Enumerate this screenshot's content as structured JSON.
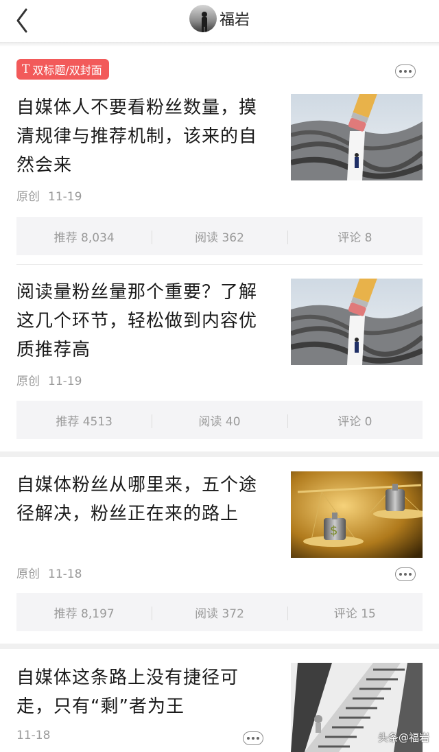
{
  "header": {
    "back_icon": "chevron-left-icon",
    "title": "福岩"
  },
  "tag": {
    "icon": "text-t-icon",
    "icon_glyph": "T",
    "label": "双标题/双封面",
    "color": "#f25a5a"
  },
  "articles": [
    {
      "title": "自媒体人不要看粉丝数量，摸清规律与推荐机制，该来的自然会来",
      "source": "原创",
      "date": "11-19",
      "recommend": "推荐 8,034",
      "read": "阅读 362",
      "comment": "评论 8"
    },
    {
      "title": "阅读量粉丝量那个重要？了解这几个环节，轻松做到内容优质推荐高",
      "source": "原创",
      "date": "11-19",
      "recommend": "推荐 4513",
      "read": "阅读 40",
      "comment": "评论 0"
    },
    {
      "title": "自媒体粉丝从哪里来，五个途径解决，粉丝正在来的路上",
      "source": "原创",
      "date": "11-18",
      "recommend": "推荐 8,197",
      "read": "阅读 372",
      "comment": "评论 15"
    },
    {
      "title": "自媒体这条路上没有捷径可走，只有“剩”者为王",
      "source": "",
      "date": "11-18"
    }
  ],
  "watermark": "头条@福岩"
}
